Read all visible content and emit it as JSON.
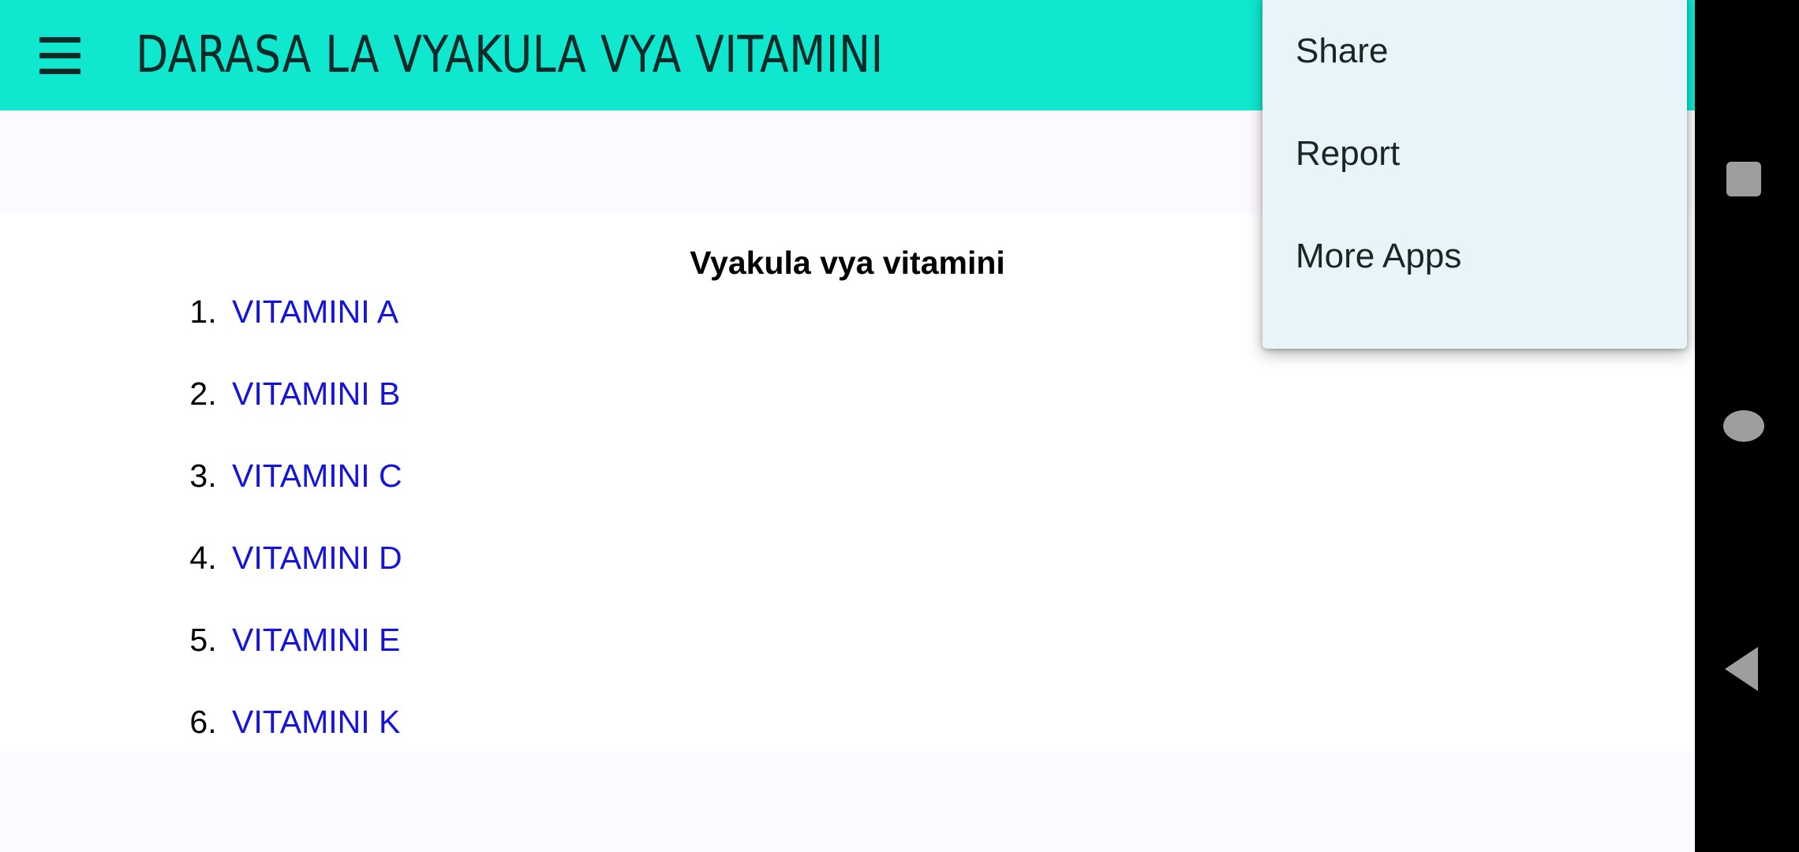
{
  "appbar": {
    "menu_icon": "hamburger-icon",
    "title": "DARASA LA VYAKULA VYA VITAMINI",
    "background_color": "#0FE8CF",
    "title_color": "#0C2B28"
  },
  "content": {
    "heading": "Vyakula vya vitamini",
    "background_color": "#FFFFFF",
    "link_color": "#1414DC",
    "list": [
      {
        "number": "1.",
        "label": "VITAMINI A"
      },
      {
        "number": "2.",
        "label": "VITAMINI B"
      },
      {
        "number": "3.",
        "label": "VITAMINI C"
      },
      {
        "number": "4.",
        "label": "VITAMINI D"
      },
      {
        "number": "5.",
        "label": "VITAMINI E"
      },
      {
        "number": "6.",
        "label": "VITAMINI K"
      }
    ]
  },
  "overflow_menu": {
    "background_color": "#E9F4F8",
    "text_color": "#1C2526",
    "items": [
      {
        "label": "Share"
      },
      {
        "label": "Report"
      },
      {
        "label": "More Apps"
      }
    ]
  },
  "navbar": {
    "background_color": "#000000",
    "icon_color": "#9E9E9E",
    "buttons": [
      {
        "icon": "recents-square-icon"
      },
      {
        "icon": "home-circle-icon"
      },
      {
        "icon": "back-triangle-icon"
      }
    ]
  }
}
